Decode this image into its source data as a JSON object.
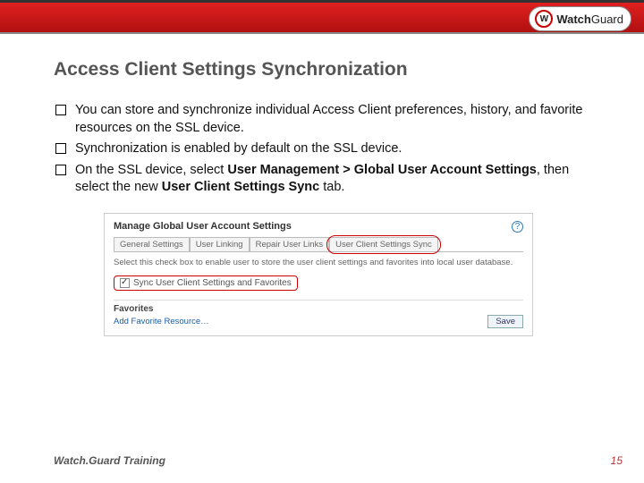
{
  "brand": {
    "name_html": "WatchGuard",
    "name_first": "Watch",
    "name_second": "Guard",
    "mark": "W"
  },
  "slide": {
    "title": "Access Client Settings Synchronization"
  },
  "bullets": [
    {
      "pre": "You can store and synchronize individual Access Client preferences, history, and favorite resources on the SSL device."
    },
    {
      "pre": "Synchronization is enabled by default on the SSL device."
    },
    {
      "pre": "On the SSL device, select ",
      "b1": "User Management > Global User Account Settings",
      "mid": ", then select the new ",
      "b2": "User Client Settings Sync",
      "post": " tab."
    }
  ],
  "screenshot": {
    "heading": "Manage Global User Account Settings",
    "tabs": [
      "General Settings",
      "User Linking",
      "Repair User Links",
      "User Client Settings Sync"
    ],
    "body": "Select this check box to enable user to store the user client settings and favorites into local user database.",
    "checkbox_label": "Sync User Client Settings and Favorites",
    "fav_heading": "Favorites",
    "fav_link": "Add Favorite Resource…",
    "save": "Save",
    "help": "?"
  },
  "footer": "Watch.Guard Training",
  "page": "15"
}
